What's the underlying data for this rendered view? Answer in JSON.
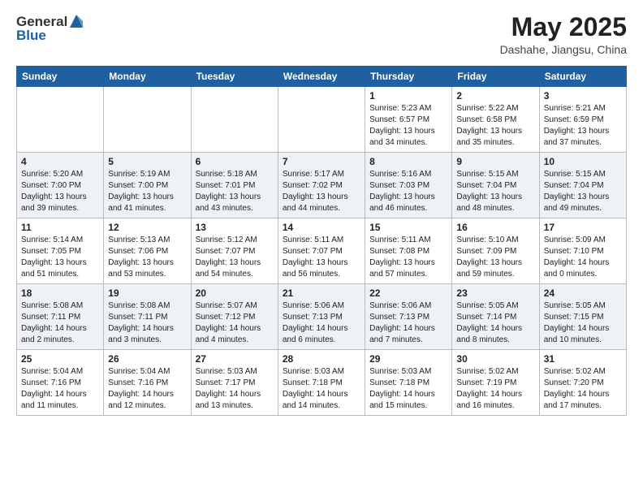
{
  "header": {
    "logo_general": "General",
    "logo_blue": "Blue",
    "month_year": "May 2025",
    "location": "Dashahe, Jiangsu, China"
  },
  "days_of_week": [
    "Sunday",
    "Monday",
    "Tuesday",
    "Wednesday",
    "Thursday",
    "Friday",
    "Saturday"
  ],
  "weeks": [
    [
      {
        "day": "",
        "sunrise": "",
        "sunset": "",
        "daylight": ""
      },
      {
        "day": "",
        "sunrise": "",
        "sunset": "",
        "daylight": ""
      },
      {
        "day": "",
        "sunrise": "",
        "sunset": "",
        "daylight": ""
      },
      {
        "day": "",
        "sunrise": "",
        "sunset": "",
        "daylight": ""
      },
      {
        "day": "1",
        "sunrise": "Sunrise: 5:23 AM",
        "sunset": "Sunset: 6:57 PM",
        "daylight": "Daylight: 13 hours and 34 minutes."
      },
      {
        "day": "2",
        "sunrise": "Sunrise: 5:22 AM",
        "sunset": "Sunset: 6:58 PM",
        "daylight": "Daylight: 13 hours and 35 minutes."
      },
      {
        "day": "3",
        "sunrise": "Sunrise: 5:21 AM",
        "sunset": "Sunset: 6:59 PM",
        "daylight": "Daylight: 13 hours and 37 minutes."
      }
    ],
    [
      {
        "day": "4",
        "sunrise": "Sunrise: 5:20 AM",
        "sunset": "Sunset: 7:00 PM",
        "daylight": "Daylight: 13 hours and 39 minutes."
      },
      {
        "day": "5",
        "sunrise": "Sunrise: 5:19 AM",
        "sunset": "Sunset: 7:00 PM",
        "daylight": "Daylight: 13 hours and 41 minutes."
      },
      {
        "day": "6",
        "sunrise": "Sunrise: 5:18 AM",
        "sunset": "Sunset: 7:01 PM",
        "daylight": "Daylight: 13 hours and 43 minutes."
      },
      {
        "day": "7",
        "sunrise": "Sunrise: 5:17 AM",
        "sunset": "Sunset: 7:02 PM",
        "daylight": "Daylight: 13 hours and 44 minutes."
      },
      {
        "day": "8",
        "sunrise": "Sunrise: 5:16 AM",
        "sunset": "Sunset: 7:03 PM",
        "daylight": "Daylight: 13 hours and 46 minutes."
      },
      {
        "day": "9",
        "sunrise": "Sunrise: 5:15 AM",
        "sunset": "Sunset: 7:04 PM",
        "daylight": "Daylight: 13 hours and 48 minutes."
      },
      {
        "day": "10",
        "sunrise": "Sunrise: 5:15 AM",
        "sunset": "Sunset: 7:04 PM",
        "daylight": "Daylight: 13 hours and 49 minutes."
      }
    ],
    [
      {
        "day": "11",
        "sunrise": "Sunrise: 5:14 AM",
        "sunset": "Sunset: 7:05 PM",
        "daylight": "Daylight: 13 hours and 51 minutes."
      },
      {
        "day": "12",
        "sunrise": "Sunrise: 5:13 AM",
        "sunset": "Sunset: 7:06 PM",
        "daylight": "Daylight: 13 hours and 53 minutes."
      },
      {
        "day": "13",
        "sunrise": "Sunrise: 5:12 AM",
        "sunset": "Sunset: 7:07 PM",
        "daylight": "Daylight: 13 hours and 54 minutes."
      },
      {
        "day": "14",
        "sunrise": "Sunrise: 5:11 AM",
        "sunset": "Sunset: 7:07 PM",
        "daylight": "Daylight: 13 hours and 56 minutes."
      },
      {
        "day": "15",
        "sunrise": "Sunrise: 5:11 AM",
        "sunset": "Sunset: 7:08 PM",
        "daylight": "Daylight: 13 hours and 57 minutes."
      },
      {
        "day": "16",
        "sunrise": "Sunrise: 5:10 AM",
        "sunset": "Sunset: 7:09 PM",
        "daylight": "Daylight: 13 hours and 59 minutes."
      },
      {
        "day": "17",
        "sunrise": "Sunrise: 5:09 AM",
        "sunset": "Sunset: 7:10 PM",
        "daylight": "Daylight: 14 hours and 0 minutes."
      }
    ],
    [
      {
        "day": "18",
        "sunrise": "Sunrise: 5:08 AM",
        "sunset": "Sunset: 7:11 PM",
        "daylight": "Daylight: 14 hours and 2 minutes."
      },
      {
        "day": "19",
        "sunrise": "Sunrise: 5:08 AM",
        "sunset": "Sunset: 7:11 PM",
        "daylight": "Daylight: 14 hours and 3 minutes."
      },
      {
        "day": "20",
        "sunrise": "Sunrise: 5:07 AM",
        "sunset": "Sunset: 7:12 PM",
        "daylight": "Daylight: 14 hours and 4 minutes."
      },
      {
        "day": "21",
        "sunrise": "Sunrise: 5:06 AM",
        "sunset": "Sunset: 7:13 PM",
        "daylight": "Daylight: 14 hours and 6 minutes."
      },
      {
        "day": "22",
        "sunrise": "Sunrise: 5:06 AM",
        "sunset": "Sunset: 7:13 PM",
        "daylight": "Daylight: 14 hours and 7 minutes."
      },
      {
        "day": "23",
        "sunrise": "Sunrise: 5:05 AM",
        "sunset": "Sunset: 7:14 PM",
        "daylight": "Daylight: 14 hours and 8 minutes."
      },
      {
        "day": "24",
        "sunrise": "Sunrise: 5:05 AM",
        "sunset": "Sunset: 7:15 PM",
        "daylight": "Daylight: 14 hours and 10 minutes."
      }
    ],
    [
      {
        "day": "25",
        "sunrise": "Sunrise: 5:04 AM",
        "sunset": "Sunset: 7:16 PM",
        "daylight": "Daylight: 14 hours and 11 minutes."
      },
      {
        "day": "26",
        "sunrise": "Sunrise: 5:04 AM",
        "sunset": "Sunset: 7:16 PM",
        "daylight": "Daylight: 14 hours and 12 minutes."
      },
      {
        "day": "27",
        "sunrise": "Sunrise: 5:03 AM",
        "sunset": "Sunset: 7:17 PM",
        "daylight": "Daylight: 14 hours and 13 minutes."
      },
      {
        "day": "28",
        "sunrise": "Sunrise: 5:03 AM",
        "sunset": "Sunset: 7:18 PM",
        "daylight": "Daylight: 14 hours and 14 minutes."
      },
      {
        "day": "29",
        "sunrise": "Sunrise: 5:03 AM",
        "sunset": "Sunset: 7:18 PM",
        "daylight": "Daylight: 14 hours and 15 minutes."
      },
      {
        "day": "30",
        "sunrise": "Sunrise: 5:02 AM",
        "sunset": "Sunset: 7:19 PM",
        "daylight": "Daylight: 14 hours and 16 minutes."
      },
      {
        "day": "31",
        "sunrise": "Sunrise: 5:02 AM",
        "sunset": "Sunset: 7:20 PM",
        "daylight": "Daylight: 14 hours and 17 minutes."
      }
    ]
  ]
}
